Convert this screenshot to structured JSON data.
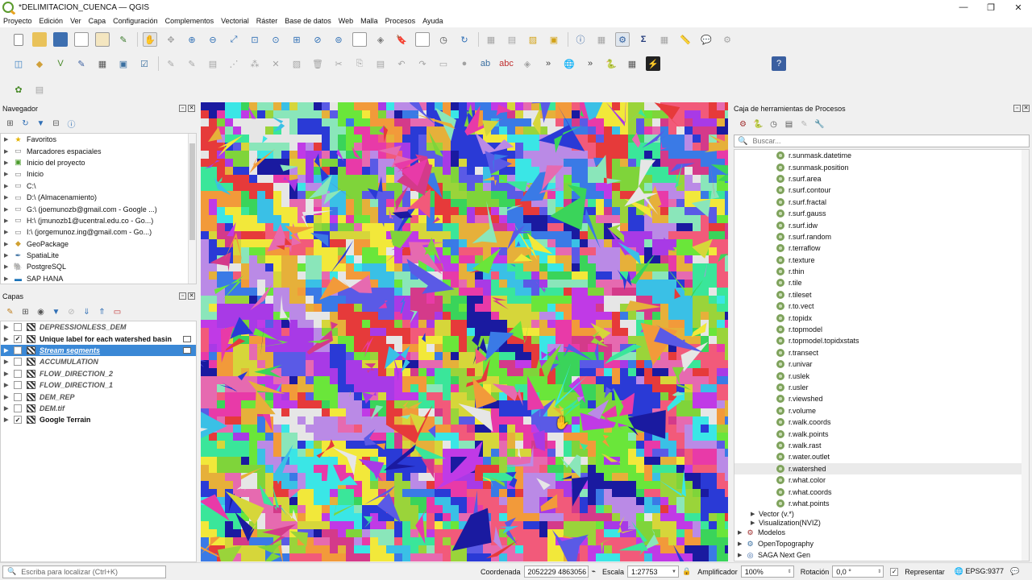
{
  "window": {
    "title": "*DELIMITACION_CUENCA — QGIS",
    "controls": [
      "—",
      "❐",
      "✕"
    ]
  },
  "menu": [
    "Proyecto",
    "Edición",
    "Ver",
    "Capa",
    "Configuración",
    "Complementos",
    "Vectorial",
    "Ráster",
    "Base de datos",
    "Web",
    "Malla",
    "Procesos",
    "Ayuda"
  ],
  "navigator": {
    "title": "Navegador",
    "items": [
      {
        "label": "Favoritos",
        "icon": "star-icon"
      },
      {
        "label": "Marcadores espaciales",
        "icon": "bookmark-folder-icon"
      },
      {
        "label": "Inicio del proyecto",
        "icon": "project-home-icon"
      },
      {
        "label": "Inicio",
        "icon": "home-folder-icon"
      },
      {
        "label": "C:\\",
        "icon": "folder-icon"
      },
      {
        "label": "D:\\ (Almacenamiento)",
        "icon": "folder-icon"
      },
      {
        "label": "G:\\ (joemunozb@gmail.com - Google ...)",
        "icon": "folder-icon"
      },
      {
        "label": "H:\\ (jmunozb1@ucentral.edu.co - Go...)",
        "icon": "folder-icon"
      },
      {
        "label": "I:\\ (jorgemunoz.ing@gmail.com - Go...)",
        "icon": "folder-icon"
      },
      {
        "label": "GeoPackage",
        "icon": "geopackage-icon"
      },
      {
        "label": "SpatiaLite",
        "icon": "spatialite-icon"
      },
      {
        "label": "PostgreSQL",
        "icon": "postgresql-icon"
      },
      {
        "label": "SAP HANA",
        "icon": "sap-hana-icon"
      }
    ]
  },
  "layers": {
    "title": "Capas",
    "items": [
      {
        "label": "DEPRESSIONLESS_DEM",
        "checked": false,
        "selected": false
      },
      {
        "label": "Unique label for each watershed basin",
        "checked": true,
        "selected": false
      },
      {
        "label": "Stream segments",
        "checked": false,
        "selected": true
      },
      {
        "label": "ACCUMULATION",
        "checked": false,
        "selected": false
      },
      {
        "label": "FLOW_DIRECTION_2",
        "checked": false,
        "selected": false
      },
      {
        "label": "FLOW_DIRECTION_1",
        "checked": false,
        "selected": false
      },
      {
        "label": "DEM_REP",
        "checked": false,
        "selected": false
      },
      {
        "label": "DEM.tif",
        "checked": false,
        "selected": false
      },
      {
        "label": "Google Terrain",
        "checked": true,
        "selected": false
      }
    ]
  },
  "processing": {
    "title": "Caja de herramientas de Procesos",
    "search_placeholder": "Buscar...",
    "algorithms": [
      "r.sunmask.datetime",
      "r.sunmask.position",
      "r.surf.area",
      "r.surf.contour",
      "r.surf.fractal",
      "r.surf.gauss",
      "r.surf.idw",
      "r.surf.random",
      "r.terraflow",
      "r.texture",
      "r.thin",
      "r.tile",
      "r.tileset",
      "r.to.vect",
      "r.topidx",
      "r.topmodel",
      "r.topmodel.topidxstats",
      "r.transect",
      "r.univar",
      "r.uslek",
      "r.usler",
      "r.viewshed",
      "r.volume",
      "r.walk.coords",
      "r.walk.points",
      "r.walk.rast",
      "r.water.outlet",
      "r.watershed",
      "r.what.color",
      "r.what.coords",
      "r.what.points"
    ],
    "highlighted": "r.watershed",
    "groups": [
      {
        "label": "Vector (v.*)",
        "level": 2
      },
      {
        "label": "Visualization(NVIZ)",
        "level": 2
      },
      {
        "label": "Modelos",
        "level": 1
      },
      {
        "label": "OpenTopography",
        "level": 1
      },
      {
        "label": "SAGA Next Gen",
        "level": 1
      }
    ]
  },
  "status": {
    "locator_placeholder": "Escriba para localizar (Ctrl+K)",
    "coord_label": "Coordenada",
    "coord_value": "2052229  4863056",
    "scale_label": "Escala",
    "scale_value": "1:27753",
    "magnifier_label": "Amplificador",
    "magnifier_value": "100%",
    "rotation_label": "Rotación",
    "rotation_value": "0,0 °",
    "render_label": "Representar",
    "epsg": "EPSG:9377"
  }
}
